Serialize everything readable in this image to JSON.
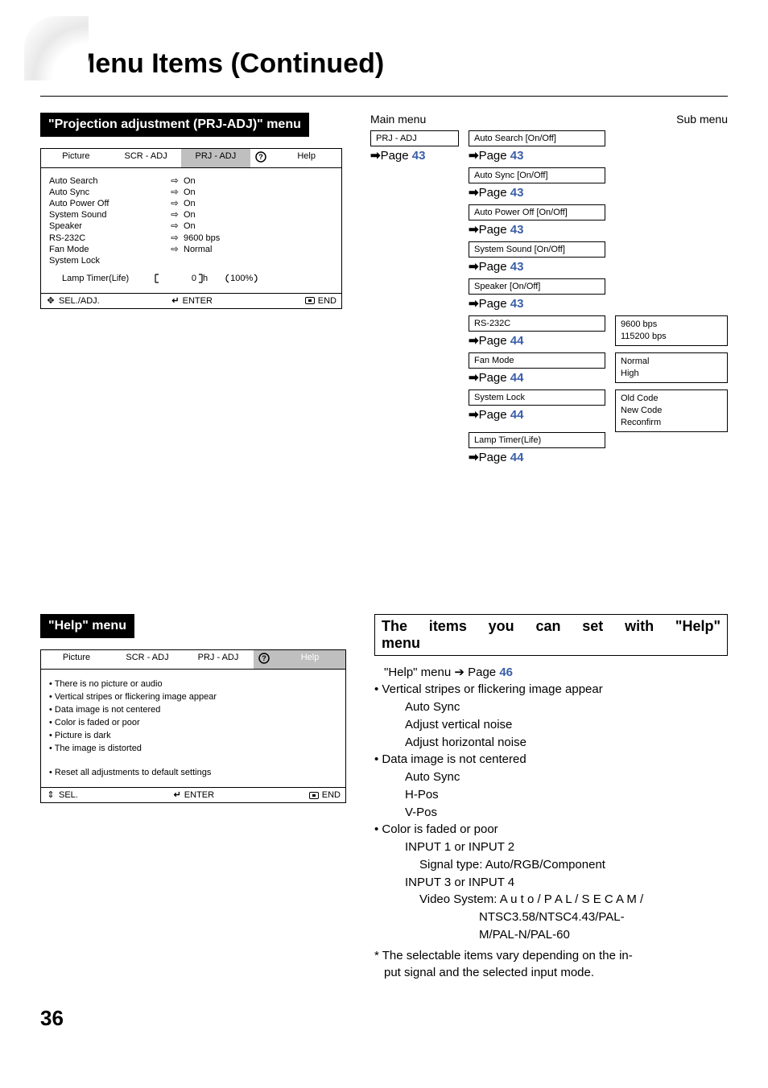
{
  "page": {
    "number": "36",
    "title": "Menu Items (Continued)"
  },
  "section1": {
    "heading": "\"Projection adjustment (PRJ-ADJ)\" menu",
    "osd": {
      "tabs": {
        "picture": "Picture",
        "scr": "SCR - ADJ",
        "prj": "PRJ - ADJ",
        "q": "?",
        "help": "Help"
      },
      "items": [
        {
          "label": "Auto Search",
          "value": "On"
        },
        {
          "label": "Auto Sync",
          "value": "On"
        },
        {
          "label": "Auto Power Off",
          "value": "On"
        },
        {
          "label": "System Sound",
          "value": "On"
        },
        {
          "label": "Speaker",
          "value": "On"
        },
        {
          "label": "RS-232C",
          "value": "9600 bps"
        },
        {
          "label": "Fan Mode",
          "value": "Normal"
        },
        {
          "label": "System Lock",
          "value": ""
        }
      ],
      "lamp": {
        "label": "Lamp Timer(Life)",
        "hours": "0",
        "h_unit": "h",
        "pct": "100%"
      },
      "footer": {
        "sel": "SEL./ADJ.",
        "enter": "ENTER",
        "end": "END"
      }
    },
    "tree": {
      "main_label": "Main menu",
      "sub_label": "Sub menu",
      "root": {
        "title": "PRJ - ADJ",
        "page": "43"
      },
      "nodes": [
        {
          "title": "Auto Search [On/Off]",
          "page": "43"
        },
        {
          "title": "Auto Sync [On/Off]",
          "page": "43"
        },
        {
          "title": "Auto Power Off [On/Off]",
          "page": "43"
        },
        {
          "title": "System Sound [On/Off]",
          "page": "43"
        },
        {
          "title": "Speaker [On/Off]",
          "page": "43"
        },
        {
          "title": "RS-232C",
          "page": "44",
          "sub": [
            "9600 bps",
            "115200 bps"
          ]
        },
        {
          "title": "Fan Mode",
          "page": "44",
          "sub": [
            "Normal",
            "High"
          ]
        },
        {
          "title": "System Lock",
          "page": "44",
          "sub": [
            "Old Code",
            "New Code",
            "Reconfirm"
          ]
        },
        {
          "title": "Lamp Timer(Life)",
          "page": "44"
        }
      ],
      "page_prefix": "Page "
    }
  },
  "section2": {
    "heading": "\"Help\" menu",
    "osd": {
      "tabs": {
        "picture": "Picture",
        "scr": "SCR - ADJ",
        "prj": "PRJ - ADJ",
        "q": "?",
        "help": "Help"
      },
      "items": [
        "There is no picture or audio",
        "Vertical stripes or flickering image appear",
        "Data image is not centered",
        "Color is faded or poor",
        "Picture is dark",
        "The image is distorted"
      ],
      "reset": "Reset all adjustments to default settings",
      "footer": {
        "sel": "SEL.",
        "enter": "ENTER",
        "end": "END"
      }
    },
    "right": {
      "title_l1": "The items you can set with \"Help\"",
      "title_l2": "menu",
      "intro_pre": "\"Help\" menu ",
      "intro_post": " Page ",
      "intro_page": "46",
      "content": [
        {
          "type": "bul",
          "text": "• Vertical stripes or flickering image appear"
        },
        {
          "type": "ind1",
          "text": "Auto Sync"
        },
        {
          "type": "ind1",
          "text": "Adjust vertical noise"
        },
        {
          "type": "ind1",
          "text": "Adjust horizontal noise"
        },
        {
          "type": "bul",
          "text": "• Data image is not centered"
        },
        {
          "type": "ind1",
          "text": "Auto Sync"
        },
        {
          "type": "ind1",
          "text": "H-Pos"
        },
        {
          "type": "ind1",
          "text": "V-Pos"
        },
        {
          "type": "bul",
          "text": "• Color is faded or poor"
        },
        {
          "type": "ind1",
          "text": "INPUT 1 or INPUT 2"
        },
        {
          "type": "ind2",
          "text": "Signal type: Auto/RGB/Component"
        },
        {
          "type": "ind1",
          "text": "INPUT 3 or INPUT 4"
        },
        {
          "type": "ind2",
          "text": "Video System: A u t o / P A L / S E C A M /"
        },
        {
          "type": "ind3",
          "text": "NTSC3.58/NTSC4.43/PAL-"
        },
        {
          "type": "ind3",
          "text": "M/PAL-N/PAL-60"
        }
      ],
      "footnote": "* The selectable items vary depending on the in-",
      "footnote2": "  put signal and the selected input mode."
    }
  }
}
